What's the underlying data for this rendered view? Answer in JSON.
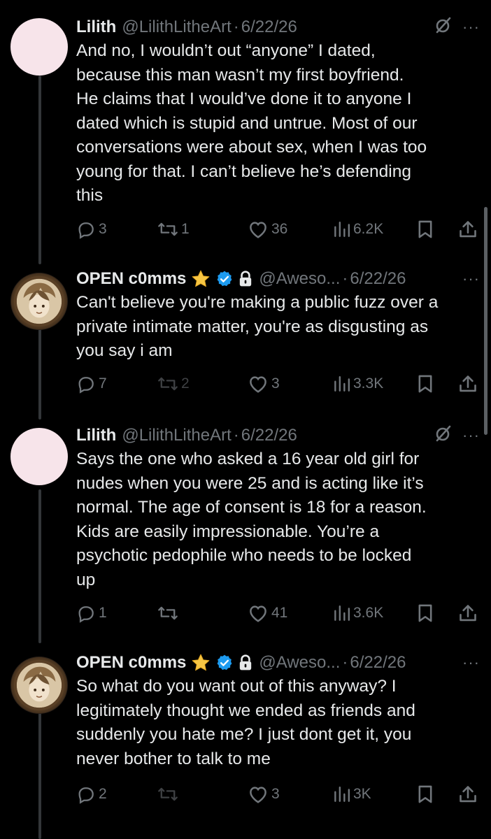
{
  "tweets": [
    {
      "name": "Lilith",
      "handle": "@LilithLitheArt",
      "separator": "·",
      "date": "6/22/26",
      "more": "···",
      "text": "And no, I wouldn’t out “anyone” I dated,\nbecause this man wasn’t my first boyfriend.\nHe claims that I would’ve done it to anyone I\ndated which is stupid and untrue. Most of our\nconversations were about sex, when I was too\nyoung for that. I can’t believe he’s defending\nthis",
      "replies": "3",
      "reposts": "1",
      "likes": "36",
      "views": "6.2K"
    },
    {
      "name": "OPEN c0mms",
      "handle": "@Aweso...",
      "separator": "·",
      "date": "6/22/26",
      "more": "···",
      "text": "Can't believe you're making a public fuzz over a\nprivate intimate matter, you're as disgusting as\nyou say i am",
      "replies": "7",
      "reposts": "2",
      "likes": "3",
      "views": "3.3K"
    },
    {
      "name": "Lilith",
      "handle": "@LilithLitheArt",
      "separator": "·",
      "date": "6/22/26",
      "more": "···",
      "text": "Says the one who asked a 16 year old girl for\nnudes when you were 25 and is acting like it’s\nnormal. The age of consent is 18 for a reason.\nKids are easily impressionable. You’re a\npsychotic pedophile who needs to be locked\nup",
      "replies": "1",
      "reposts": "",
      "likes": "41",
      "views": "3.6K"
    },
    {
      "name": "OPEN c0mms",
      "handle": "@Aweso...",
      "separator": "·",
      "date": "6/22/26",
      "more": "···",
      "text": "So what do you want out of this anyway? I\nlegitimately thought we ended as friends and\nsuddenly you hate me? I just dont get it, you\nnever bother to talk to me",
      "replies": "2",
      "reposts": "",
      "likes": "3",
      "views": "3K"
    }
  ],
  "icons": {
    "reply": "reply-icon",
    "repost": "repost-icon",
    "like": "heart-icon",
    "views": "views-icon",
    "bookmark": "bookmark-icon",
    "share": "share-icon",
    "verified": "verified-badge-icon",
    "protected": "lock-icon",
    "star": "star-emoji-icon",
    "grok": "grok-icon"
  },
  "colors": {
    "background": "#000000",
    "text": "#e7e9ea",
    "muted": "#71767b",
    "verified": "#1d9bf0",
    "thread_line": "#333639"
  }
}
